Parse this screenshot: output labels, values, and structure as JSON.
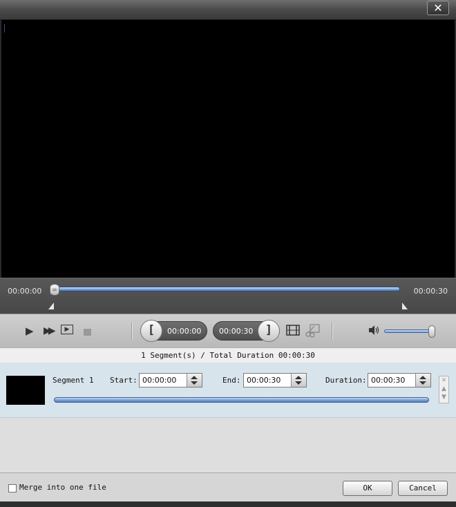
{
  "window": {
    "close_label": "✕"
  },
  "seek": {
    "current_time": "00:00:00",
    "total_time": "00:00:30",
    "position_fraction": 0.0
  },
  "controls": {
    "play_icon": "play-icon",
    "fast_forward_icon": "fast-forward-icon",
    "step_icon": "step-frame-icon",
    "stop_icon": "stop-icon",
    "start_marker_time": "00:00:00",
    "end_marker_time": "00:00:30",
    "set_start_icon": "[",
    "set_end_icon": "]",
    "volume_fraction": 0.95
  },
  "summary": {
    "text": "1 Segment(s) / Total Duration 00:00:30"
  },
  "segments": [
    {
      "name": "Segment 1",
      "start_label": "Start:",
      "start": "00:00:00",
      "end_label": "End:",
      "end": "00:00:30",
      "duration_label": "Duration:",
      "duration": "00:00:30"
    }
  ],
  "footer": {
    "merge_label": "Merge into one file",
    "merge_checked": false,
    "ok_label": "OK",
    "cancel_label": "Cancel"
  },
  "colors": {
    "accent": "#7fa7d8",
    "panel": "#d8e4ec"
  }
}
